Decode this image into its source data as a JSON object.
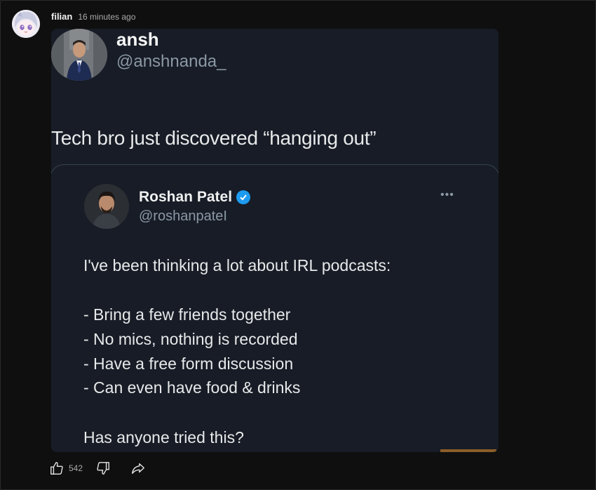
{
  "post": {
    "author": "filian",
    "time": "16 minutes ago",
    "likes": "542"
  },
  "tweet": {
    "name": "ansh",
    "handle": "@anshnanda_",
    "text": "Tech bro just discovered “hanging out”"
  },
  "quoted": {
    "name": "Roshan Patel",
    "handle": "@roshanpateI",
    "more": "•••",
    "lines": [
      "I've been thinking a lot about IRL podcasts:",
      "- Bring a few friends together",
      "- No mics, nothing is recorded",
      "- Have a free form discussion",
      "- Can even have food & drinks",
      "Has anyone tried this?"
    ]
  },
  "colors": {
    "background": "#0f0f0f",
    "tweet_bg": "#171c26",
    "verified": "#1d9bf0",
    "handle": "#8b98a5"
  }
}
